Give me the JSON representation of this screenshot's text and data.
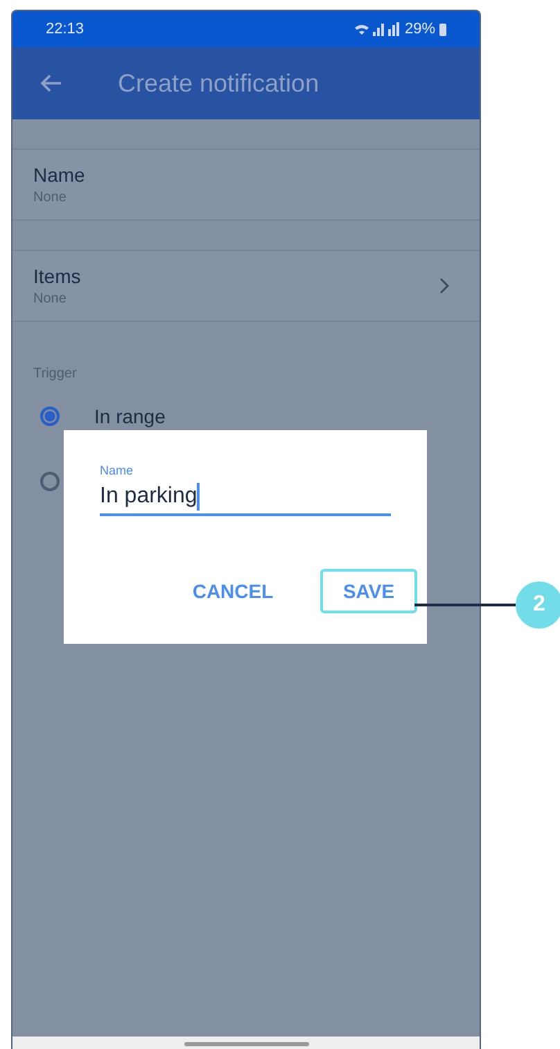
{
  "status_bar": {
    "time": "22:13",
    "battery": "29%"
  },
  "app_bar": {
    "title": "Create notification"
  },
  "rows": [
    {
      "title": "Name",
      "value": "None",
      "chevron": false
    },
    {
      "title": "Items",
      "value": "None",
      "chevron": true
    }
  ],
  "trigger": {
    "label": "Trigger",
    "options": [
      {
        "label": "In range",
        "selected": true
      },
      {
        "selected": false
      }
    ]
  },
  "dialog": {
    "field_label": "Name",
    "value": "In parking",
    "buttons": [
      {
        "label": "CANCEL",
        "highlighted": false
      },
      {
        "label": "SAVE",
        "highlighted": true
      }
    ]
  },
  "callout": {
    "number": "2"
  }
}
